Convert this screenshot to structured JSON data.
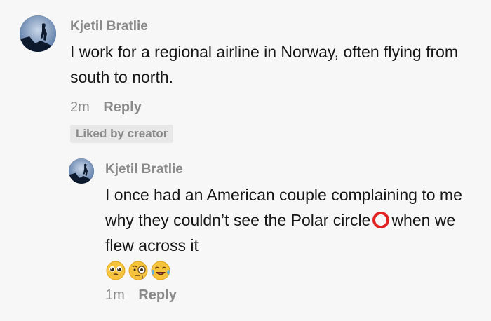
{
  "comment": {
    "username": "Kjetil Bratlie",
    "text": "I work for a regional airline in Norway, often flying from south to north.",
    "time": "2m",
    "reply_label": "Reply",
    "liked_badge": "Liked by creator"
  },
  "reply": {
    "username": "Kjetil Bratlie",
    "text_line1": "I once had an American couple complaining to me why they couldn’t see the Polar circle",
    "text_line2": "when we flew across it",
    "circle_icon": "hollow-red-circle-icon",
    "emojis": [
      "pleading-face-icon",
      "face-with-monocle-icon",
      "tears-of-joy-icon"
    ],
    "time": "1m",
    "reply_label": "Reply"
  },
  "colors": {
    "background": "#f7f7f7",
    "username": "#8a8a8a",
    "text": "#161616",
    "badge_bg": "#e8e8e8",
    "red_circle": "#e02424"
  }
}
